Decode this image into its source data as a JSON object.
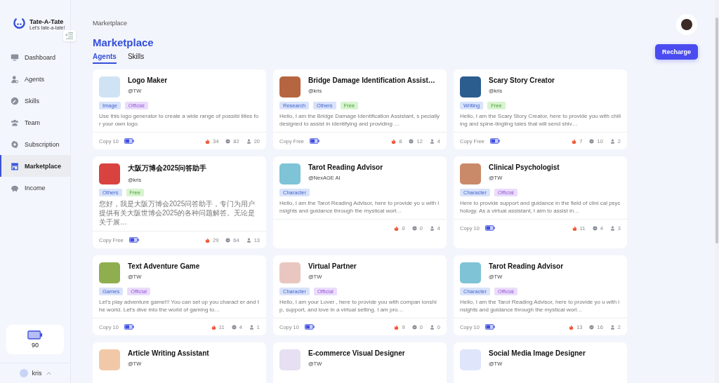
{
  "brand": {
    "name": "Tate-A-Tate",
    "tagline": "Let's tate-a-tate!"
  },
  "sidebar": {
    "items": [
      {
        "label": "Dashboard",
        "selected": false
      },
      {
        "label": "Agents",
        "selected": false
      },
      {
        "label": "Skills",
        "selected": false
      },
      {
        "label": "Team",
        "selected": false
      },
      {
        "label": "Subscription",
        "selected": false
      },
      {
        "label": "Marketplace",
        "selected": true
      },
      {
        "label": "Income",
        "selected": false
      }
    ],
    "balance": "90",
    "user": "kris"
  },
  "breadcrumb": "Marketplace",
  "title": "Marketplace",
  "recharge_button": "Recharge",
  "tabs": [
    {
      "label": "Agents",
      "selected": true
    },
    {
      "label": "Skills",
      "selected": false
    }
  ],
  "cards": [
    {
      "name": "Logo Maker",
      "author": "@TW",
      "tags": [
        {
          "label": "Image",
          "kind": "category"
        },
        {
          "label": "Official",
          "kind": "official"
        }
      ],
      "description": "Use this logo generator to create a wide range of possibi lities for your own logo.",
      "copy": "Copy 10",
      "likes": "34",
      "comments": "82",
      "users": "20"
    },
    {
      "name": "Bridge Damage Identification Assist…",
      "author": "@kris",
      "tags": [
        {
          "label": "Research",
          "kind": "category"
        },
        {
          "label": "Others",
          "kind": "category"
        },
        {
          "label": "Free",
          "kind": "free"
        }
      ],
      "description": "Hello, I am the Bridge Damage Identification Assistant, s pecially designed to assist in identifying and providing …",
      "copy": "Copy Free",
      "likes": "8",
      "comments": "12",
      "users": "4"
    },
    {
      "name": "Scary Story Creator",
      "author": "@kris",
      "tags": [
        {
          "label": "Writing",
          "kind": "category"
        },
        {
          "label": "Free",
          "kind": "free"
        }
      ],
      "description": "Hello, I am the Scary Story Creator, here to provide you with chilling and spine-tingling tales that will send shiv…",
      "copy": "Copy Free",
      "likes": "7",
      "comments": "10",
      "users": "2"
    },
    {
      "name": "大阪万博会2025问答助手",
      "author": "@kris",
      "tags": [
        {
          "label": "Others",
          "kind": "category"
        },
        {
          "label": "Free",
          "kind": "free"
        }
      ],
      "description": "您好，我是大阪万博会2025问答助手，专门为用户提供有关大阪世博会2025的各种问题解答。无论是关于展…",
      "copy": "Copy Free",
      "likes": "29",
      "comments": "64",
      "users": "13"
    },
    {
      "name": "Tarot Reading Advisor",
      "author": "@NexAGE AI",
      "tags": [
        {
          "label": "Character",
          "kind": "category"
        }
      ],
      "description": "Hello, I am the Tarot Reading Advisor, here to provide yo u with insights and guidance through the mystical worl…",
      "likes": "0",
      "comments": "0",
      "users": "4"
    },
    {
      "name": "Clinical Psychologist",
      "author": "@TW",
      "tags": [
        {
          "label": "Character",
          "kind": "category"
        },
        {
          "label": "Official",
          "kind": "official"
        }
      ],
      "description": "Here to provide support and guidance in the field of clini cal psychology. As a virtual assistant, I aim to assist in…",
      "copy": "Copy 10",
      "likes": "11",
      "comments": "4",
      "users": "3"
    },
    {
      "name": "Text Adventure Game",
      "author": "@TW",
      "tags": [
        {
          "label": "Games",
          "kind": "category"
        },
        {
          "label": "Official",
          "kind": "official"
        }
      ],
      "description": "Let's play adventure game!!! You can set up you charact er and the world. Let's dive into the world of gaming to…",
      "copy": "Copy 10",
      "likes": "11",
      "comments": "4",
      "users": "1"
    },
    {
      "name": "Virtual Partner",
      "author": "@TW",
      "tags": [
        {
          "label": "Character",
          "kind": "category"
        },
        {
          "label": "Official",
          "kind": "official"
        }
      ],
      "description": "Hello, I am your Lover , here to provide you with compan ionship, support, and love in a virtual setting. I am pro…",
      "copy": "Copy 10",
      "likes": "9",
      "comments": "0",
      "users": "0"
    },
    {
      "name": "Tarot Reading Advisor",
      "author": "@TW",
      "tags": [
        {
          "label": "Character",
          "kind": "category"
        },
        {
          "label": "Official",
          "kind": "official"
        }
      ],
      "description": "Hello, I am the Tarot Reading Advisor, here to provide yo u with insights and guidance through the mystical worl…",
      "copy": "Copy 10",
      "likes": "13",
      "comments": "16",
      "users": "2"
    },
    {
      "name": "Article Writing Assistant",
      "author": "@TW"
    },
    {
      "name": "E-commerce Visual Designer",
      "author": "@TW"
    },
    {
      "name": "Social Media Image Designer",
      "author": "@TW"
    }
  ]
}
